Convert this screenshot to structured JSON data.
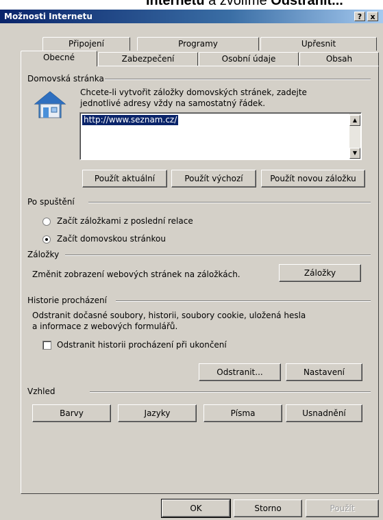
{
  "caption": {
    "prefix": "Internetu",
    "middle": " a zvolíme ",
    "suffix": "Odstranit..."
  },
  "window": {
    "title": "Možnosti Internetu",
    "help_btn": "?",
    "close_btn": "x"
  },
  "tabs_back": [
    "Připojení",
    "Programy",
    "Upřesnit"
  ],
  "tabs_front": [
    "Obecné",
    "Zabezpečení",
    "Osobní údaje",
    "Obsah"
  ],
  "home": {
    "group_label": "Domovská stránka",
    "description_line1": "Chcete-li vytvořit záložky domovských stránek, zadejte",
    "description_line2": "jednotlivé adresy vždy na samostatný řádek.",
    "url_value": "http://www.seznam.cz/",
    "buttons": [
      "Použít aktuální",
      "Použít výchozí",
      "Použít novou záložku"
    ]
  },
  "startup": {
    "group_label": "Po spuštění",
    "option1": "Začít záložkami z poslední relace",
    "option2": "Začít domovskou stránkou",
    "selected": 2
  },
  "tabs_section": {
    "group_label": "Záložky",
    "description": "Změnit zobrazení webových stránek na záložkách.",
    "button": "Záložky"
  },
  "history": {
    "group_label": "Historie procházení",
    "description_line1": "Odstranit dočasné soubory, historii, soubory cookie, uložená hesla",
    "description_line2": "a informace z webových formulářů.",
    "checkbox_label": "Odstranit historii procházení při ukončení",
    "checked": false,
    "delete_button": "Odstranit...",
    "settings_button": "Nastavení"
  },
  "appearance": {
    "group_label": "Vzhled",
    "buttons": [
      "Barvy",
      "Jazyky",
      "Písma",
      "Usnadnění"
    ]
  },
  "footer": {
    "ok": "OK",
    "cancel": "Storno",
    "apply": "Použít"
  },
  "colors": {
    "titlebar_start": "#0a246a",
    "titlebar_end": "#a6caf0",
    "face": "#d4d0c8",
    "selection": "#0a246a"
  }
}
